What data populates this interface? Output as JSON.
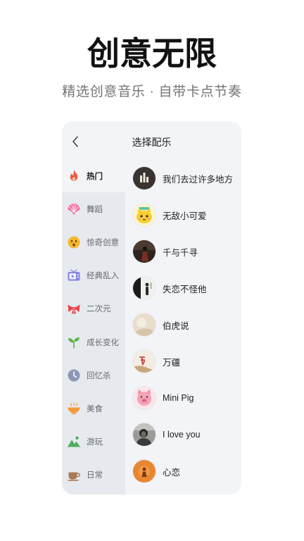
{
  "hero": {
    "title": "创意无限",
    "subtitle": "精选创意音乐 · 自带卡点节奏"
  },
  "screen": {
    "title": "选择配乐",
    "back_icon": "chevron-left-icon"
  },
  "categories": [
    {
      "label": "热门",
      "icon": "fire-icon",
      "color": "#ee5a3d",
      "selected": true
    },
    {
      "label": "舞蹈",
      "icon": "fan-icon",
      "color": "#f06b9b",
      "selected": false
    },
    {
      "label": "惊奇创意",
      "icon": "surprised-face-icon",
      "color": "#f5b82a",
      "selected": false
    },
    {
      "label": "经典乱入",
      "icon": "tv-icon",
      "color": "#8684e0",
      "selected": false
    },
    {
      "label": "二次元",
      "icon": "bow-icon",
      "color": "#e8464b",
      "selected": false
    },
    {
      "label": "成长变化",
      "icon": "sprout-icon",
      "color": "#5bb449",
      "selected": false
    },
    {
      "label": "回忆杀",
      "icon": "clock-icon",
      "color": "#8e96b6",
      "selected": false
    },
    {
      "label": "美食",
      "icon": "bowl-icon",
      "color": "#f29a38",
      "selected": false
    },
    {
      "label": "游玩",
      "icon": "mountain-icon",
      "color": "#4fae62",
      "selected": false
    },
    {
      "label": "日常",
      "icon": "cup-icon",
      "color": "#a87a56",
      "selected": false
    }
  ],
  "songs": [
    {
      "title": "我们去过许多地方"
    },
    {
      "title": "无敌小可爱"
    },
    {
      "title": "千与千寻"
    },
    {
      "title": "失恋不怪他"
    },
    {
      "title": "伯虎说"
    },
    {
      "title": "万疆"
    },
    {
      "title": "Mini Pig"
    },
    {
      "title": "I love you"
    },
    {
      "title": "心恋"
    }
  ],
  "colors": {
    "page_background": "#ffffff",
    "card_background": "#f2f4f7",
    "sidebar_background": "#e6e9ee",
    "title_text": "#111111",
    "subtitle_text": "#747474"
  }
}
